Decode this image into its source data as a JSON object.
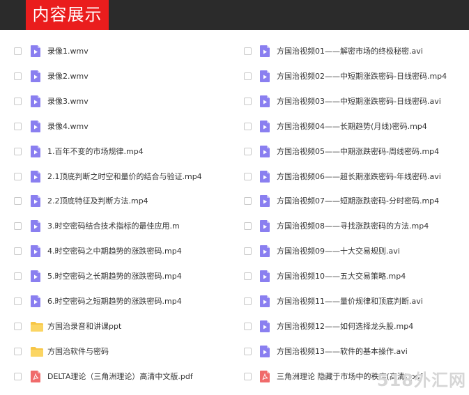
{
  "header": {
    "title": "内容展示"
  },
  "files": {
    "left": [
      {
        "name": "录像1.wmv",
        "icon": "video-file-icon"
      },
      {
        "name": "录像2.wmv",
        "icon": "video-file-icon"
      },
      {
        "name": "录像3.wmv",
        "icon": "video-file-icon"
      },
      {
        "name": "录像4.wmv",
        "icon": "video-file-icon"
      },
      {
        "name": "1.百年不变的市场规律.mp4",
        "icon": "video-file-icon"
      },
      {
        "name": "2.1顶底判断之时空和量价的结合与验证.mp4",
        "icon": "video-file-icon"
      },
      {
        "name": "2.2顶底特征及判断方法.mp4",
        "icon": "video-file-icon"
      },
      {
        "name": "3.时空密码结合技术指标的最佳应用.m",
        "icon": "video-file-icon"
      },
      {
        "name": "4.时空密码之中期趋势的涨跌密码.mp4",
        "icon": "video-file-icon"
      },
      {
        "name": "5.时空密码之长期趋势的涨跌密码.mp4",
        "icon": "video-file-icon"
      },
      {
        "name": "6.时空密码之短期趋势的涨跌密码.mp4",
        "icon": "video-file-icon"
      },
      {
        "name": "方国治录音和讲课ppt",
        "icon": "folder-icon"
      },
      {
        "name": "方国治软件与密码",
        "icon": "folder-icon"
      },
      {
        "name": "DELTA理论（三角洲理论）高清中文版.pdf",
        "icon": "pdf-file-icon"
      }
    ],
    "right": [
      {
        "name": "方国治视频01——解密市场的终极秘密.avi",
        "icon": "video-file-icon"
      },
      {
        "name": "方国治视频02——中短期涨跌密码-日线密码.mp4",
        "icon": "video-file-icon"
      },
      {
        "name": "方国治视频03——中短期涨跌密码-日线密码.avi",
        "icon": "video-file-icon"
      },
      {
        "name": "方国治视频04——长期趋势(月线)密码.mp4",
        "icon": "video-file-icon"
      },
      {
        "name": "方国治视频05——中期涨跌密码-周线密码.mp4",
        "icon": "video-file-icon"
      },
      {
        "name": "方国治视频06——超长期涨跌密码-年线密码.avi",
        "icon": "video-file-icon"
      },
      {
        "name": "方国治视频07——短期涨跌密码-分时密码.mp4",
        "icon": "video-file-icon"
      },
      {
        "name": "方国治视频08——寻找涨跌密码的方法.mp4",
        "icon": "video-file-icon"
      },
      {
        "name": "方国治视频09——十大交易规则.avi",
        "icon": "video-file-icon"
      },
      {
        "name": "方国治视频10——五大交易策略.mp4",
        "icon": "video-file-icon"
      },
      {
        "name": "方国治视频11——量价规律和顶底判断.avi",
        "icon": "video-file-icon"
      },
      {
        "name": "方国治视频12——如何选择龙头股.mp4",
        "icon": "video-file-icon"
      },
      {
        "name": "方国治视频13——软件的基本操作.avi",
        "icon": "video-file-icon"
      },
      {
        "name": "三角洲理论 隐藏于市场中的秩序(高清).pdf",
        "icon": "pdf-file-icon"
      }
    ]
  },
  "watermark": "518外汇网",
  "colors": {
    "header_bg": "#2b2b2b",
    "title_bg": "#ea1d1d",
    "video_icon": "#8a7ff0",
    "folder_icon": "#f7c646",
    "pdf_icon": "#f06b6b"
  }
}
